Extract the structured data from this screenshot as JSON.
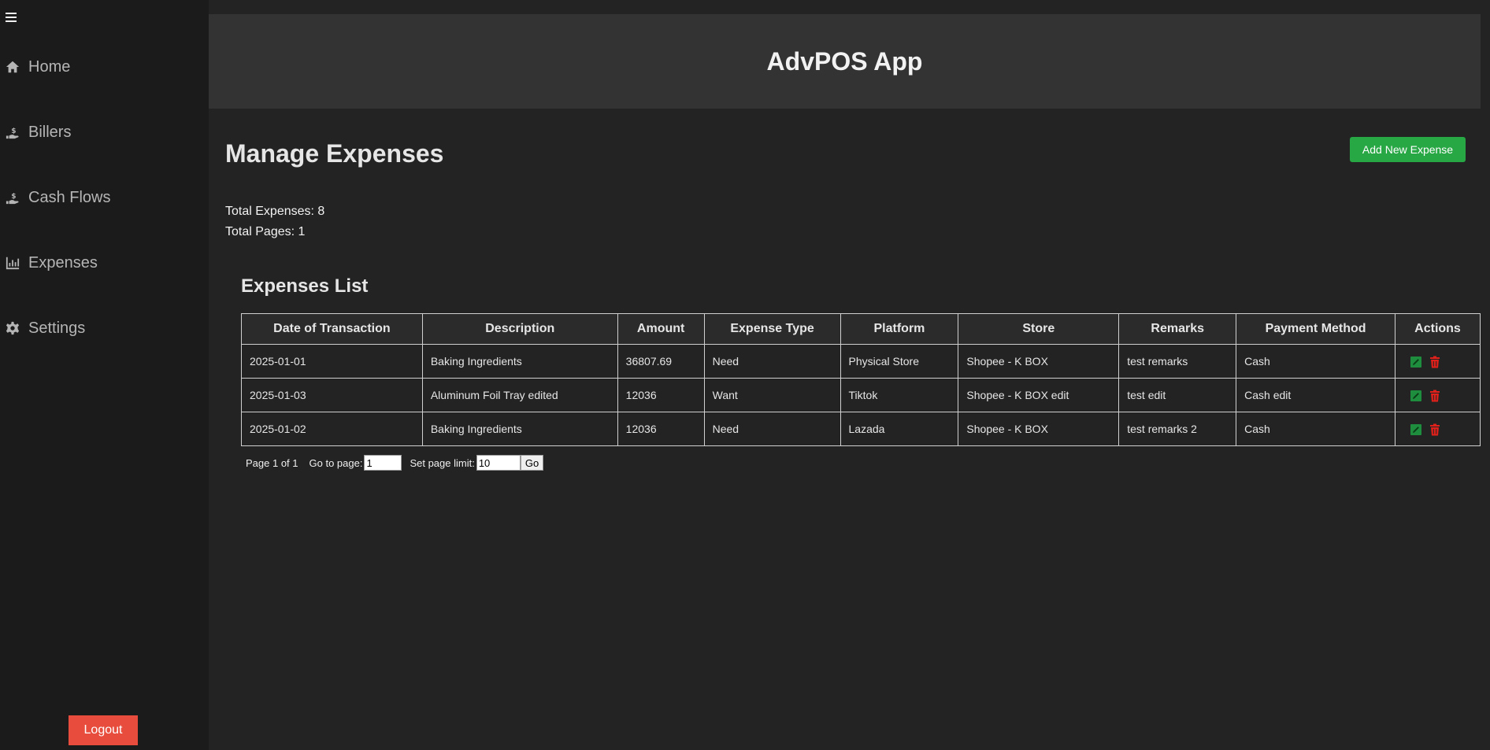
{
  "sidebar": {
    "items": [
      {
        "label": "Home",
        "icon": "home-icon"
      },
      {
        "label": "Billers",
        "icon": "hand-dollar-icon"
      },
      {
        "label": "Cash Flows",
        "icon": "hand-dollar-icon"
      },
      {
        "label": "Expenses",
        "icon": "bar-chart-icon"
      },
      {
        "label": "Settings",
        "icon": "gear-icon"
      }
    ],
    "logout_label": "Logout"
  },
  "header": {
    "title": "AdvPOS App"
  },
  "page": {
    "title": "Manage Expenses",
    "add_button": "Add New Expense",
    "total_expenses": "Total Expenses: 8",
    "total_pages": "Total Pages: 1",
    "list_title": "Expenses List"
  },
  "table": {
    "columns": [
      "Date of Transaction",
      "Description",
      "Amount",
      "Expense Type",
      "Platform",
      "Store",
      "Remarks",
      "Payment Method",
      "Actions"
    ],
    "rows": [
      [
        "2025-01-01",
        "Baking Ingredients",
        "36807.69",
        "Need",
        "Physical Store",
        "Shopee - K BOX",
        "test remarks",
        "Cash"
      ],
      [
        "2025-01-03",
        "Aluminum Foil Tray edited",
        "12036",
        "Want",
        "Tiktok",
        "Shopee - K BOX edit",
        "test edit",
        "Cash edit"
      ],
      [
        "2025-01-02",
        "Baking Ingredients",
        "12036",
        "Need",
        "Lazada",
        "Shopee - K BOX",
        "test remarks 2",
        "Cash"
      ]
    ]
  },
  "pager": {
    "page_info": "Page 1 of 1",
    "goto_label": "Go to page:",
    "goto_value": "1",
    "limit_label": "Set page limit:",
    "limit_value": "10",
    "go_label": "Go"
  },
  "colors": {
    "edit": "#1e8e3e",
    "delete": "#e0201a",
    "add_button": "#28a745",
    "logout": "#e74c3c"
  }
}
